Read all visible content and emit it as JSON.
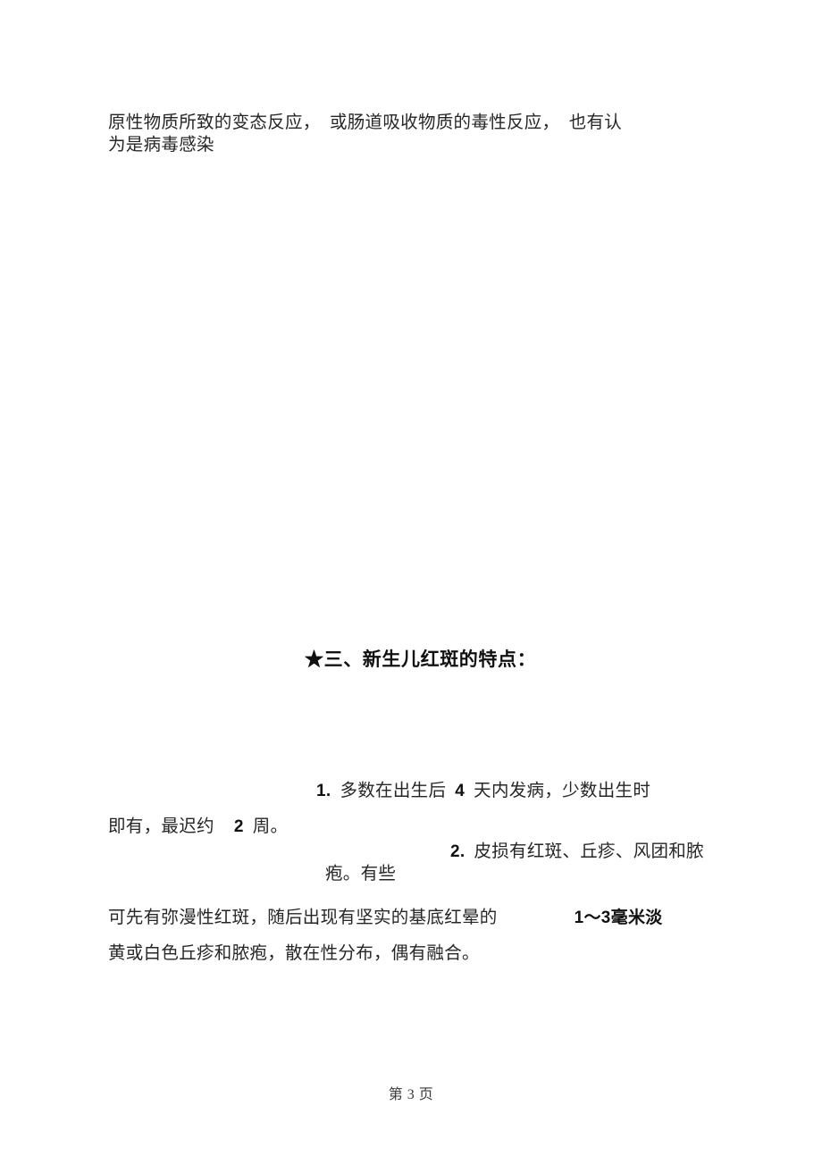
{
  "document": {
    "page_background": "#ffffff",
    "text_color": "#262626",
    "intro_paragraph": {
      "lines": [
        "原性物质所致的变态反应，  或肠道吸收物质的毒性反应，  也有认",
        "为是病毒感染"
      ]
    },
    "section_heading": {
      "bullet": "★",
      "text": "★三、新生儿红斑的特点："
    },
    "list": {
      "items": [
        {
          "marker": "1.",
          "line1_text": "多数在出生后",
          "emphasis1": "4",
          "line1_text2": "天内发病，少数出生时",
          "line2_text": "即有，最迟约",
          "emphasis2": "2",
          "line2_text2": "周。"
        },
        {
          "marker": "2.",
          "line1_text": "皮损有红斑、丘疹、风团和脓",
          "line2_text": "疱。有些",
          "line3_text": "可先有弥漫性红斑，随后出现有坚实的基底红晕的",
          "emphasis1": "1～3毫米淡",
          "line4_text": "黄或白色丘疹和脓疱，散在性分布，偶有融合。"
        }
      ]
    },
    "footer": {
      "page_label": "第 3 页"
    }
  }
}
